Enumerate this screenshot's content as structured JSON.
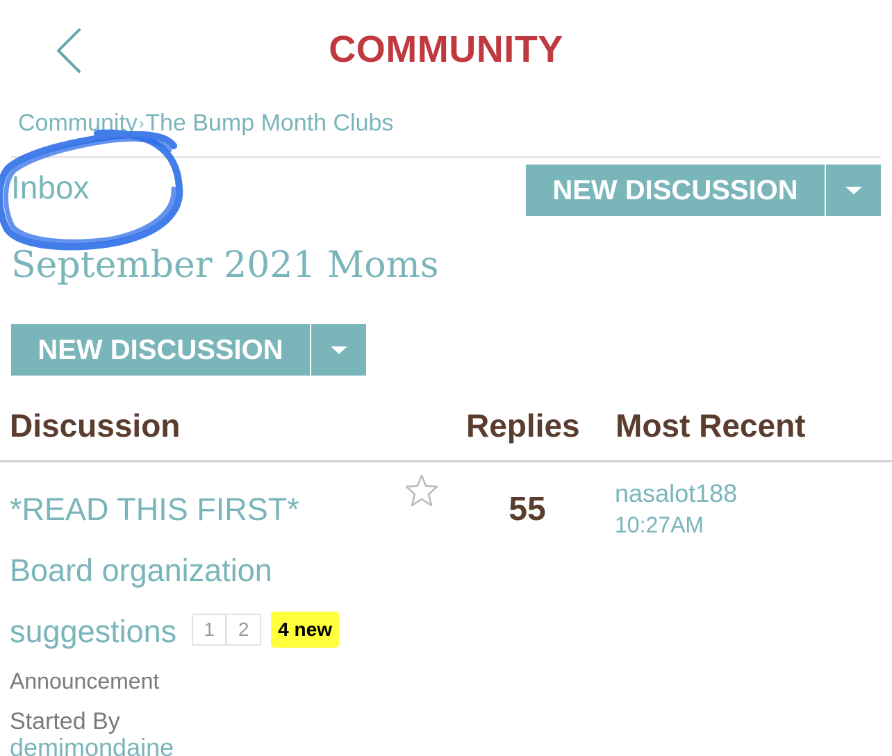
{
  "header": {
    "title": "COMMUNITY",
    "back_icon": "chevron-left-icon"
  },
  "breadcrumb": {
    "items": [
      "Community",
      "The Bump Month Clubs"
    ],
    "separator": "›"
  },
  "inbox_label": "Inbox",
  "new_discussion_label": "NEW DISCUSSION",
  "board_title": "September 2021 Moms",
  "table": {
    "headers": {
      "discussion": "Discussion",
      "replies": "Replies",
      "most_recent": "Most Recent"
    },
    "rows": [
      {
        "title": "*READ THIS FIRST* Board organization suggestions",
        "pages": [
          "1",
          "2"
        ],
        "new_badge": "4 new",
        "category": "Announcement",
        "started_by_label": "Started By",
        "started_by": "demimondaine",
        "replies": "55",
        "recent_user": "nasalot188",
        "recent_time": "10:27AM"
      }
    ]
  },
  "colors": {
    "accent": "#7ab5ba",
    "title_red": "#c0393f",
    "header_brown": "#5a3d2e",
    "badge_yellow": "#ffff3c",
    "annotation_blue": "#2f6fe8"
  }
}
